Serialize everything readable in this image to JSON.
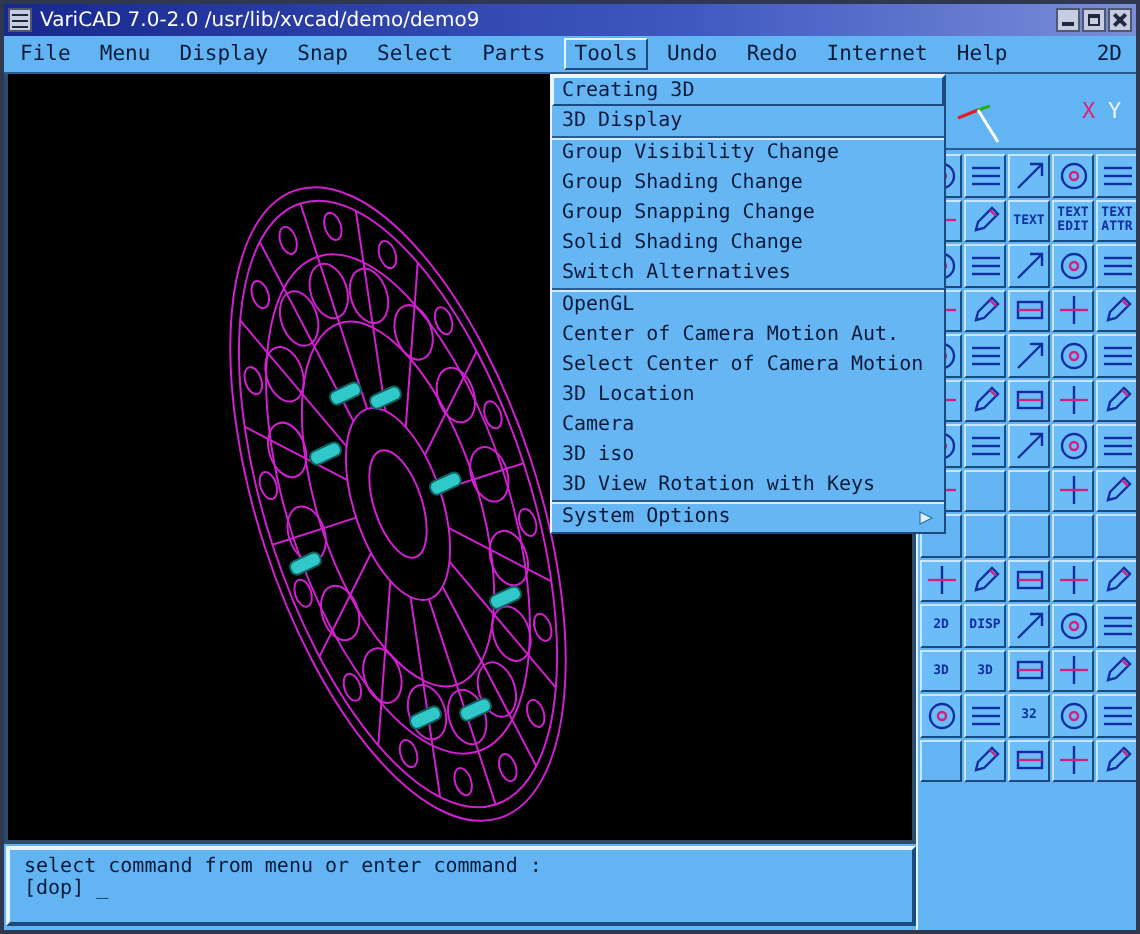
{
  "window": {
    "title": "VariCAD 7.0-2.0 /usr/lib/xvcad/demo/demo9"
  },
  "menubar": [
    {
      "label": "File",
      "selected": false
    },
    {
      "label": "Menu",
      "selected": false
    },
    {
      "label": "Display",
      "selected": false
    },
    {
      "label": "Snap",
      "selected": false
    },
    {
      "label": "Select",
      "selected": false
    },
    {
      "label": "Parts",
      "selected": false
    },
    {
      "label": "Tools",
      "selected": true
    },
    {
      "label": "Undo",
      "selected": false
    },
    {
      "label": "Redo",
      "selected": false
    },
    {
      "label": "Internet",
      "selected": false
    },
    {
      "label": "Help",
      "selected": false
    }
  ],
  "mode": "2D",
  "tools_menu": {
    "groups": [
      [
        {
          "label": "Creating 3D",
          "selected": true
        },
        {
          "label": "3D Display",
          "selected": false
        }
      ],
      [
        {
          "label": "Group Visibility Change",
          "selected": false
        },
        {
          "label": "Group Shading Change",
          "selected": false
        },
        {
          "label": "Group Snapping Change",
          "selected": false
        },
        {
          "label": "Solid Shading Change",
          "selected": false
        },
        {
          "label": "Switch Alternatives",
          "selected": false
        }
      ],
      [
        {
          "label": "OpenGL",
          "selected": false
        },
        {
          "label": "Center of Camera Motion Aut.",
          "selected": false
        },
        {
          "label": "Select Center of Camera Motion",
          "selected": false
        },
        {
          "label": "3D Location",
          "selected": false
        },
        {
          "label": "Camera",
          "selected": false
        },
        {
          "label": "3D iso",
          "selected": false
        },
        {
          "label": "3D View Rotation with Keys",
          "selected": false
        }
      ],
      [
        {
          "label": "System Options",
          "selected": false,
          "submenu": true
        }
      ]
    ]
  },
  "axis": {
    "x": "X",
    "y": "Y"
  },
  "palette": [
    [
      {
        "kind": "icon"
      },
      {
        "kind": "icon"
      },
      {
        "kind": "icon"
      },
      {
        "kind": "icon"
      },
      {
        "kind": "icon"
      }
    ],
    [
      {
        "kind": "icon"
      },
      {
        "kind": "icon"
      },
      {
        "kind": "text",
        "label": "TEXT"
      },
      {
        "kind": "text",
        "label": "TEXT EDIT"
      },
      {
        "kind": "text",
        "label": "TEXT ATTR"
      }
    ],
    [
      {
        "kind": "icon"
      },
      {
        "kind": "icon"
      },
      {
        "kind": "icon"
      },
      {
        "kind": "icon"
      },
      {
        "kind": "icon"
      }
    ],
    [
      {
        "kind": "icon"
      },
      {
        "kind": "icon"
      },
      {
        "kind": "icon"
      },
      {
        "kind": "icon"
      },
      {
        "kind": "icon"
      }
    ],
    [
      {
        "kind": "icon"
      },
      {
        "kind": "icon"
      },
      {
        "kind": "icon"
      },
      {
        "kind": "icon"
      },
      {
        "kind": "icon"
      }
    ],
    [
      {
        "kind": "icon"
      },
      {
        "kind": "icon"
      },
      {
        "kind": "icon"
      },
      {
        "kind": "icon"
      },
      {
        "kind": "icon"
      }
    ],
    [
      {
        "kind": "icon"
      },
      {
        "kind": "icon"
      },
      {
        "kind": "icon"
      },
      {
        "kind": "icon"
      },
      {
        "kind": "icon"
      }
    ],
    [
      {
        "kind": "icon"
      },
      {
        "kind": "blank"
      },
      {
        "kind": "blank"
      },
      {
        "kind": "icon"
      },
      {
        "kind": "icon"
      }
    ],
    [
      {
        "kind": "blank"
      },
      {
        "kind": "blank"
      },
      {
        "kind": "blank"
      },
      {
        "kind": "blank"
      },
      {
        "kind": "blank"
      }
    ],
    [
      {
        "kind": "icon"
      },
      {
        "kind": "icon"
      },
      {
        "kind": "icon"
      },
      {
        "kind": "icon"
      },
      {
        "kind": "icon"
      }
    ],
    [
      {
        "kind": "text",
        "label": "2D"
      },
      {
        "kind": "text",
        "label": "DISP"
      },
      {
        "kind": "icon"
      },
      {
        "kind": "icon"
      },
      {
        "kind": "icon"
      }
    ],
    [
      {
        "kind": "text",
        "label": "3D"
      },
      {
        "kind": "text",
        "label": "3D"
      },
      {
        "kind": "icon"
      },
      {
        "kind": "icon"
      },
      {
        "kind": "icon"
      }
    ],
    [
      {
        "kind": "icon"
      },
      {
        "kind": "icon"
      },
      {
        "kind": "text",
        "label": "32"
      },
      {
        "kind": "icon"
      },
      {
        "kind": "icon"
      }
    ],
    [
      {
        "kind": "blank"
      },
      {
        "kind": "icon"
      },
      {
        "kind": "icon"
      },
      {
        "kind": "icon"
      },
      {
        "kind": "icon"
      }
    ]
  ],
  "command": {
    "lines": [
      "select command from menu or enter command :",
      "[dop] _"
    ]
  }
}
